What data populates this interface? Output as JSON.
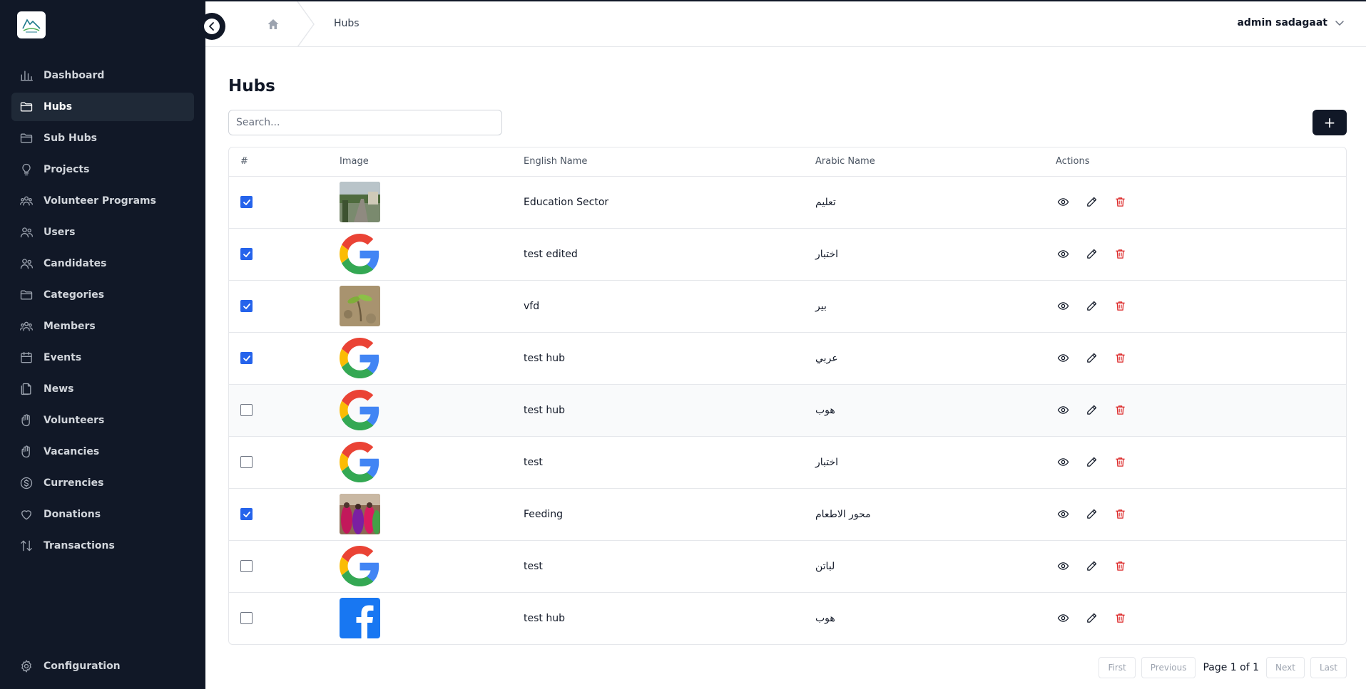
{
  "sidebar": {
    "items": [
      {
        "label": "Dashboard",
        "icon": "bar-chart-icon"
      },
      {
        "label": "Hubs",
        "icon": "folder-icon",
        "active": true
      },
      {
        "label": "Sub Hubs",
        "icon": "folder-icon"
      },
      {
        "label": "Projects",
        "icon": "lightbulb-icon"
      },
      {
        "label": "Volunteer Programs",
        "icon": "users-group-icon"
      },
      {
        "label": "Users",
        "icon": "users-icon"
      },
      {
        "label": "Candidates",
        "icon": "users-icon"
      },
      {
        "label": "Categories",
        "icon": "folder-icon"
      },
      {
        "label": "Members",
        "icon": "users-group-icon"
      },
      {
        "label": "Events",
        "icon": "calendar-icon"
      },
      {
        "label": "News",
        "icon": "document-icon"
      },
      {
        "label": "Volunteers",
        "icon": "hand-icon"
      },
      {
        "label": "Vacancies",
        "icon": "hand-icon"
      },
      {
        "label": "Currencies",
        "icon": "dollar-icon"
      },
      {
        "label": "Donations",
        "icon": "heart-icon"
      },
      {
        "label": "Transactions",
        "icon": "arrows-updown-icon"
      }
    ],
    "config_label": "Configuration"
  },
  "header": {
    "breadcrumb": "Hubs",
    "user_name": "admin sadagaat"
  },
  "main": {
    "title": "Hubs",
    "search_placeholder": "Search...",
    "add_label": "+",
    "columns": [
      "#",
      "Image",
      "English Name",
      "Arabic Name",
      "Actions"
    ],
    "rows": [
      {
        "checked": true,
        "image": "photo-road",
        "english": "Education Sector",
        "arabic": "تعليم"
      },
      {
        "checked": true,
        "image": "google-logo",
        "english": "test edited",
        "arabic": "اختبار"
      },
      {
        "checked": true,
        "image": "photo-plant",
        "english": "vfd",
        "arabic": "بير"
      },
      {
        "checked": true,
        "image": "google-logo",
        "english": "test hub",
        "arabic": "عربي"
      },
      {
        "checked": false,
        "image": "google-logo",
        "english": "test hub",
        "arabic": "هوب"
      },
      {
        "checked": false,
        "image": "google-logo",
        "english": "test",
        "arabic": "اختبار"
      },
      {
        "checked": true,
        "image": "photo-people",
        "english": "Feeding",
        "arabic": "محور الاطعام"
      },
      {
        "checked": false,
        "image": "google-logo",
        "english": "test",
        "arabic": "لباتن"
      },
      {
        "checked": false,
        "image": "facebook-logo",
        "english": "test hub",
        "arabic": "هوب"
      }
    ]
  },
  "pagination": {
    "first": "First",
    "previous": "Previous",
    "info": "Page 1 of 1",
    "next": "Next",
    "last": "Last"
  },
  "colors": {
    "sidebar_bg": "#111827",
    "checkbox": "#2563eb",
    "delete": "#dc2626"
  }
}
